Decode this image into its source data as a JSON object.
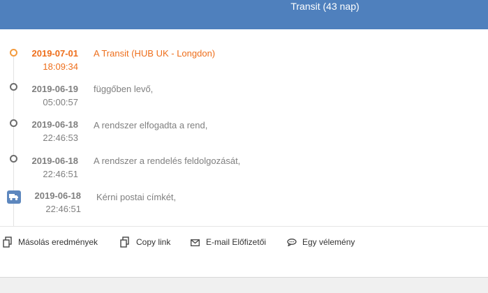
{
  "header": {
    "title": "Transit (43 nap)"
  },
  "events": [
    {
      "date": "2019-07-01",
      "time": "18:09:34",
      "desc": "A Transit (HUB UK - Longdon)"
    },
    {
      "date": "2019-06-19",
      "time": "05:00:57",
      "desc": "függőben levő,"
    },
    {
      "date": "2019-06-18",
      "time": "22:46:53",
      "desc": "A rendszer elfogadta a rend,"
    },
    {
      "date": "2019-06-18",
      "time": "22:46:51",
      "desc": "A rendszer a rendelés feldolgozását,"
    },
    {
      "date": "2019-06-18",
      "time": "22:46:51",
      "desc": "Kérni postai címkét,"
    }
  ],
  "actions": {
    "copy_results": "Másolás eredmények",
    "copy_link": "Copy link",
    "email_subscribe": "E-mail Előfizetői",
    "feedback": "Egy vélemény"
  },
  "colors": {
    "header_bg": "#4f80bd",
    "active": "#ee6e1b",
    "text_muted": "#7f7f7f",
    "truck_badge": "#5d87be"
  },
  "icons": {
    "active_event": "orange-ring-dot-icon",
    "event": "gray-ring-dot-icon",
    "shipment": "truck-icon",
    "copy": "copy-icon",
    "email": "envelope-icon",
    "feedback": "speech-bubble-icon"
  }
}
